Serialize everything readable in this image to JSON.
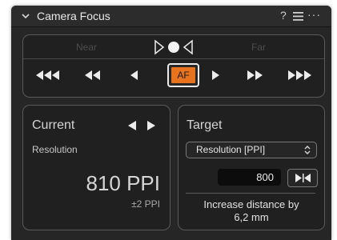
{
  "header": {
    "title": "Camera Focus",
    "help": "?",
    "more": "···"
  },
  "focus": {
    "near_label": "Near",
    "far_label": "Far",
    "af_label": "AF"
  },
  "current": {
    "label": "Current",
    "metric": "Resolution",
    "value": "810 PPI",
    "tolerance": "±2 PPI"
  },
  "target": {
    "label": "Target",
    "metric_select": "Resolution [PPI]",
    "value": "800",
    "message_line1": "Increase distance by",
    "message_line2": "6,2 mm"
  },
  "colors": {
    "accent": "#e8731e",
    "panel": "#262626"
  }
}
